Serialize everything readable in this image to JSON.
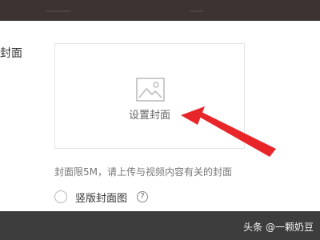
{
  "colors": {
    "top_bar": "#3d3332",
    "bottom_bar": "#3d3d3d",
    "annotation_arrow": "#e8262a",
    "box_border": "#e3e3e3"
  },
  "form": {
    "section_label": "封面",
    "cover_upload": {
      "icon": "image-icon",
      "label": "设置封面"
    },
    "hint": "封面限5M，请上传与视频内容有关的封面",
    "vertical_cover_option": {
      "label": "竖版封面图",
      "help_icon": "question-circle-icon",
      "help_glyph": "?"
    }
  },
  "watermark": "头条 @一颗奶豆"
}
